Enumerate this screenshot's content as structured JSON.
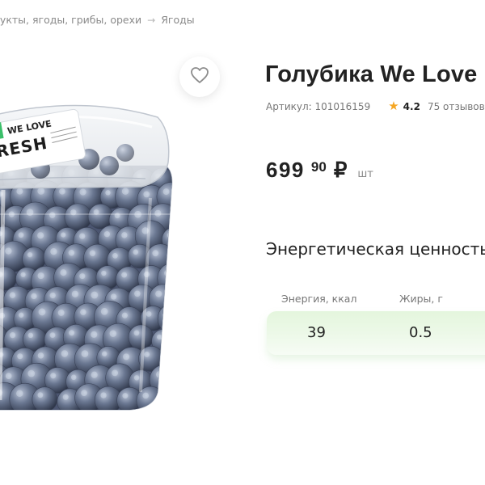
{
  "breadcrumb": {
    "items": [
      "рукты, ягоды, грибы, орехи",
      "Ягоды"
    ],
    "separator": "→"
  },
  "product": {
    "title": "Голубика We Love F",
    "article": "Артикул: 101016159",
    "rating": "4.2",
    "reviews": "75 отзывов",
    "price_main": "699",
    "price_kop": "90",
    "currency": "₽",
    "unit": "шт",
    "image_label": "blueberry-container"
  },
  "package_label": {
    "brand_top": "WE LOVE",
    "brand_bottom": "RESH"
  },
  "energy": {
    "title": "Энергетическая ценность",
    "headers": [
      "Энергия, ккал",
      "Жиры, г"
    ],
    "values": [
      "39",
      "0.5"
    ]
  },
  "colors": {
    "accent_green": "#e4f6dd",
    "star": "#f5a623"
  },
  "icons": {
    "favorite": "heart-outline-icon",
    "rating": "star-icon"
  }
}
